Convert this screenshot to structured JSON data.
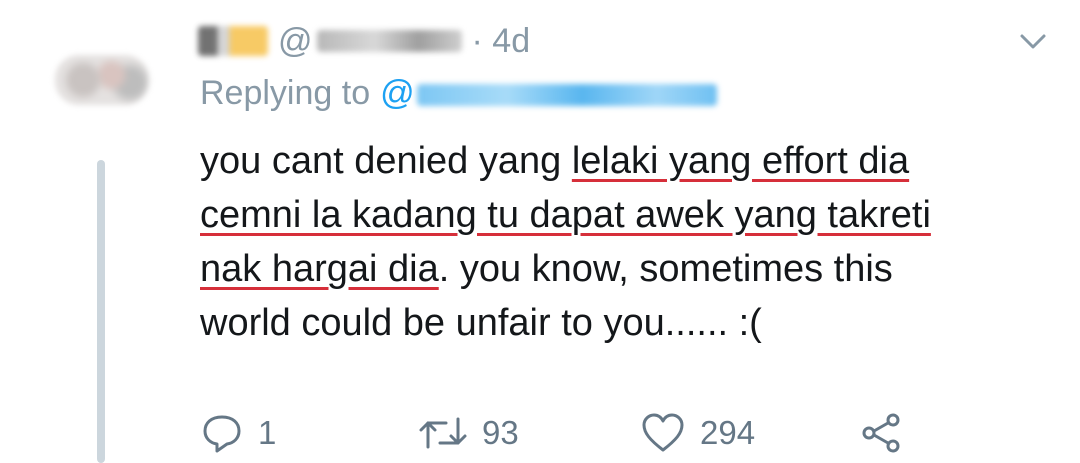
{
  "tweet": {
    "handle_prefix": "@",
    "time": "· 4d",
    "replying_label": "Replying to",
    "replying_prefix": "@",
    "text_lines": [
      {
        "normal": "you cant denied yang ",
        "underlined": "lelaki yang effort dia",
        "after": ""
      },
      {
        "normal": "",
        "underlined": "cemni la kadang tu dapat awek yang takreti",
        "after": ""
      },
      {
        "normal": "",
        "underlined": "nak hargai dia",
        "after": ". you know, sometimes this"
      },
      {
        "normal": "world could be unfair to you...... :(",
        "underlined": "",
        "after": ""
      }
    ],
    "counts": {
      "reply": "1",
      "retweet": "93",
      "like": "294"
    }
  },
  "colors": {
    "handle_gray": "#8899a6",
    "link_blue": "#1da1f2",
    "underline_red": "#d62f3a",
    "thread_line": "#ccd6dd"
  },
  "icons": {
    "menu": "chevron-down-icon",
    "reply": "reply-icon",
    "retweet": "retweet-icon",
    "like": "heart-icon",
    "share": "share-icon"
  }
}
